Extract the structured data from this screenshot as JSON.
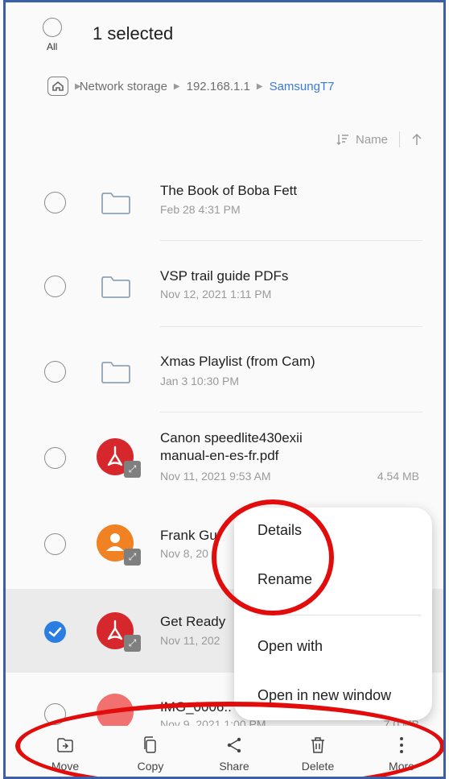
{
  "header": {
    "select_all_label": "All",
    "title": "1 selected"
  },
  "breadcrumb": {
    "items": [
      "Network storage",
      "192.168.1.1",
      "SamsungT7"
    ]
  },
  "sort": {
    "label": "Name"
  },
  "files": [
    {
      "name": "The Book of Boba Fett",
      "date": "Feb 28 4:31 PM",
      "type": "folder-icon",
      "selected": false
    },
    {
      "name": "VSP trail guide PDFs",
      "date": "Nov 12, 2021 1:11 PM",
      "type": "folder-icon",
      "selected": false
    },
    {
      "name": "Xmas Playlist (from Cam)",
      "date": "Jan 3 10:30 PM",
      "type": "folder-icon",
      "selected": false
    },
    {
      "name_line1": "Canon speedlite430exii",
      "name_line2": "manual-en-es-fr.pdf",
      "date": "Nov 11, 2021 9:53 AM",
      "size": "4.54 MB",
      "type": "pdf-icon",
      "selected": false
    },
    {
      "name": "Frank Gu",
      "date": "Nov 8, 20",
      "type": "contact-icon",
      "selected": false
    },
    {
      "name": "Get Ready",
      "date": "Nov 11, 202",
      "type": "pdf-icon",
      "selected": true
    },
    {
      "name": "IMG_0006..",
      "date": "Nov 9, 2021 1:00 PM",
      "size": "7.0 MB",
      "type": "image-icon",
      "selected": false
    }
  ],
  "context_menu": {
    "items": [
      "Details",
      "Rename",
      "Open with",
      "Open in new window"
    ]
  },
  "bottom_bar": {
    "items": [
      {
        "label": "Move",
        "icon": "move-icon"
      },
      {
        "label": "Copy",
        "icon": "copy-icon"
      },
      {
        "label": "Share",
        "icon": "share-icon"
      },
      {
        "label": "Delete",
        "icon": "delete-icon"
      },
      {
        "label": "More",
        "icon": "more-icon"
      }
    ]
  },
  "colors": {
    "accent": "#3b7bd4",
    "annotation_red": "#e20c0c",
    "pdf_red": "#d6282c",
    "contact_orange": "#f08223"
  }
}
